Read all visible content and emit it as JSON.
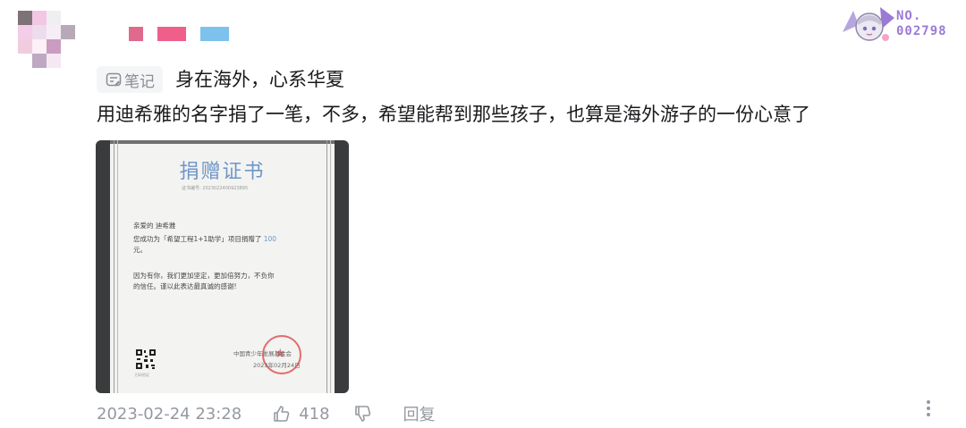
{
  "user": {
    "avatar_pixels": [
      "#7e7277",
      "#f1c7e4",
      "#f0eef0",
      "#ffffff",
      "#f4cde8",
      "#eddcec",
      "#f7edf6",
      "#b7a9b8",
      "#f1ccdf",
      "#fdf0f7",
      "#c99cc0",
      "#ffffff",
      "#ffffff",
      "#bfa8c2",
      "#f5e8f3",
      "#ffffff"
    ],
    "name_colors": [
      "#e06a8e",
      "#ef5f8a",
      "#7cc2ec"
    ]
  },
  "badge": {
    "text_line1": "NO.",
    "text_line2": "002798"
  },
  "comment": {
    "note_label": "笔记",
    "title": "身在海外，心系华夏",
    "content": "用迪希雅的名字捐了一笔，不多，希望能帮到那些孩子，也算是海外游子的一份心意了",
    "image": {
      "cert_title": "捐赠证书",
      "cert_no": "证书编号: 2023022400923895",
      "greeting": "亲爱的 迪希雅",
      "line1": "您成功为「希望工程1+1助学」项目捐赠了",
      "amount": "100",
      "unit": "元。",
      "thanks1": "因为有你，我们更加坚定，更加倍努力，不负你",
      "thanks2": "的信任。谨以此表达最真诚的感谢!",
      "org": "中国青少年发展基金会",
      "date": "2023年02月24日",
      "qr_caption": "扫码验证"
    },
    "timestamp": "2023-02-24 23:28",
    "like_count": "418",
    "reply_label": "回复"
  }
}
